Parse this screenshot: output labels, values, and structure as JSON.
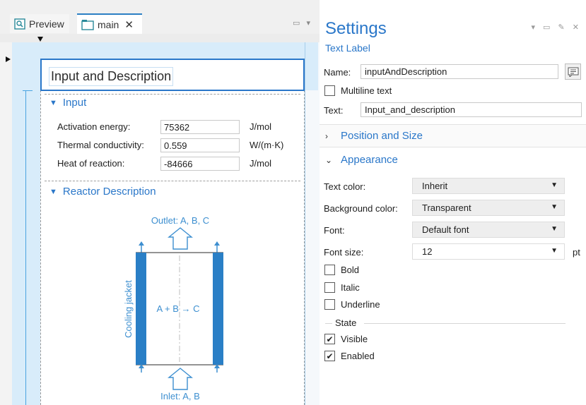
{
  "editor": {
    "tabs": [
      {
        "label": "Preview",
        "icon": "preview-icon"
      },
      {
        "label": "main",
        "icon": "form-icon"
      }
    ],
    "title_label": "Input and Description",
    "input_section": {
      "label": "Input",
      "rows": [
        {
          "label": "Activation energy:",
          "value": "75362",
          "unit": "J/mol"
        },
        {
          "label": "Thermal conductivity:",
          "value": "0.559",
          "unit": "W/(m·K)"
        },
        {
          "label": "Heat of reaction:",
          "value": "-84666",
          "unit": "J/mol"
        }
      ]
    },
    "reactor_section": {
      "label": "Reactor Description",
      "outlet": "Outlet: A, B, C",
      "inlet": "Inlet: A, B",
      "jacket": "Cooling jacket",
      "reaction": "A + B → C",
      "jacket_color": "#2a7fc6",
      "text_color": "#3d8fd0"
    }
  },
  "settings": {
    "title": "Settings",
    "subtitle": "Text Label",
    "name_label": "Name:",
    "name_value": "inputAndDescription",
    "multiline_label": "Multiline text",
    "text_label": "Text:",
    "text_value": "Input_and_description",
    "position_section": "Position and Size",
    "appearance_section": "Appearance",
    "text_color_label": "Text color:",
    "text_color_value": "Inherit",
    "bg_color_label": "Background color:",
    "bg_color_value": "Transparent",
    "font_label": "Font:",
    "font_value": "Default font",
    "font_size_label": "Font size:",
    "font_size_value": "12",
    "font_size_unit": "pt",
    "bold_label": "Bold",
    "italic_label": "Italic",
    "underline_label": "Underline",
    "state_label": "State",
    "visible_label": "Visible",
    "enabled_label": "Enabled",
    "visible_checked": true,
    "enabled_checked": true,
    "accent_color": "#2a77c9"
  }
}
